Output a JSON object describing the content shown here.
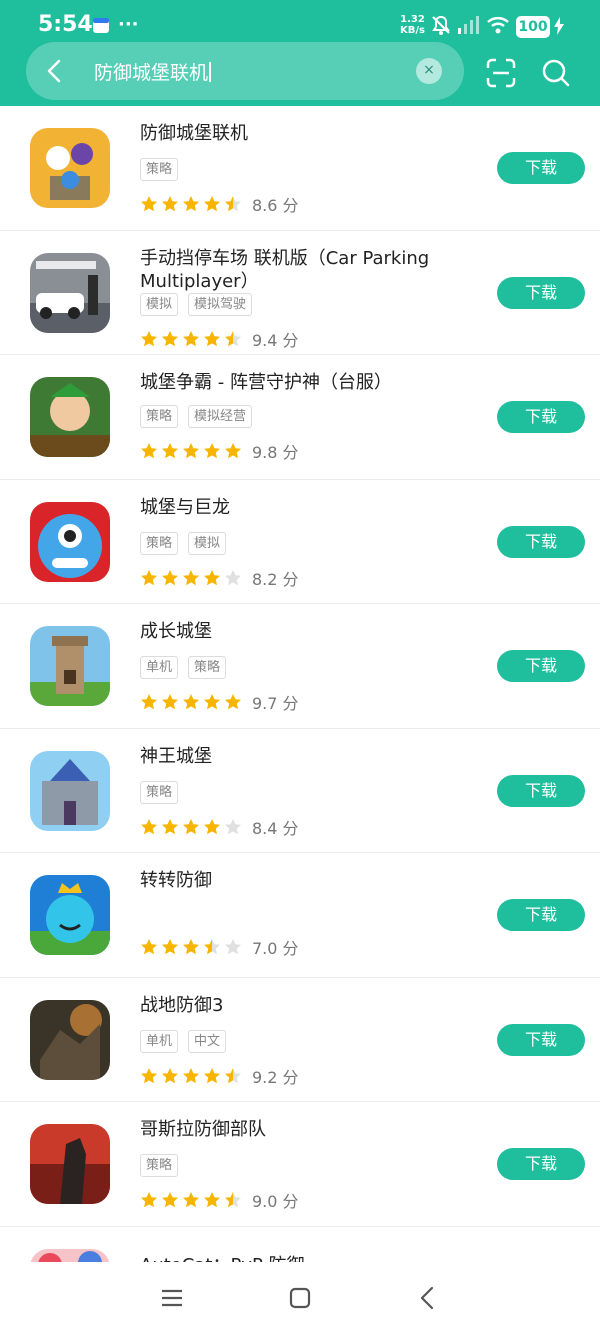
{
  "status_bar": {
    "time": "5:54",
    "net_speed_value": "1.32",
    "net_speed_unit": "KB/s",
    "battery": "100",
    "icons": [
      "calendar-icon",
      "more-dots-icon",
      "mute-bell-icon",
      "signal-icon",
      "wifi-icon",
      "charging-icon"
    ]
  },
  "search": {
    "query": "防御城堡联机",
    "clear_symbol": "×"
  },
  "download_label": "下载",
  "score_unit": "分",
  "apps": [
    {
      "name": "防御城堡联机",
      "tags": [
        "策略"
      ],
      "rating": 4.5,
      "score": "8.6"
    },
    {
      "name": "手动挡停车场 联机版（Car Parking Multiplayer）",
      "tags": [
        "模拟",
        "模拟驾驶"
      ],
      "rating": 4.5,
      "score": "9.4"
    },
    {
      "name": "城堡争霸 - 阵营守护神（台服）",
      "tags": [
        "策略",
        "模拟经营"
      ],
      "rating": 5,
      "score": "9.8"
    },
    {
      "name": "城堡与巨龙",
      "tags": [
        "策略",
        "模拟"
      ],
      "rating": 4,
      "score": "8.2"
    },
    {
      "name": "成长城堡",
      "tags": [
        "单机",
        "策略"
      ],
      "rating": 5,
      "score": "9.7"
    },
    {
      "name": "神王城堡",
      "tags": [
        "策略"
      ],
      "rating": 4,
      "score": "8.4"
    },
    {
      "name": "转转防御",
      "tags": [],
      "rating": 3.5,
      "score": "7.0"
    },
    {
      "name": "战地防御3",
      "tags": [
        "单机",
        "中文"
      ],
      "rating": 4.5,
      "score": "9.2"
    },
    {
      "name": "哥斯拉防御部队",
      "tags": [
        "策略"
      ],
      "rating": 4.5,
      "score": "9.0"
    }
  ],
  "partial_app": {
    "name": "AutoCat：PvP 防御"
  },
  "colors": {
    "accent": "#1fbf9e",
    "star": "#f7b500",
    "star_empty": "#e0e0e0"
  }
}
